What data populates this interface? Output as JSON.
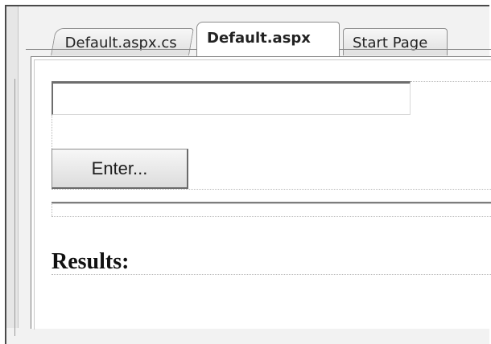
{
  "tabs": [
    {
      "label": "Default.aspx.cs",
      "active": false
    },
    {
      "label": "Default.aspx",
      "active": true
    },
    {
      "label": "Start Page",
      "active": false
    }
  ],
  "form": {
    "text_input_value": "",
    "enter_button_label": "Enter...",
    "results_heading": "Results:"
  },
  "colors": {
    "active_tab": "#ffffff",
    "inactive_tab": "#e0e0e0",
    "border": "#7d7d7d"
  }
}
